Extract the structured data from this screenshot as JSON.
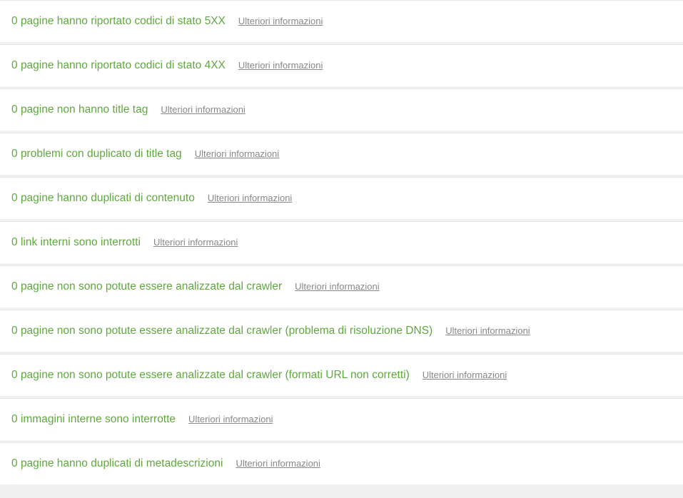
{
  "issues": [
    {
      "count": "0",
      "label": "pagine hanno riportato codici di stato 5XX",
      "more": "Ulteriori informazioni"
    },
    {
      "count": "0",
      "label": "pagine hanno riportato codici di stato 4XX",
      "more": "Ulteriori informazioni"
    },
    {
      "count": "0",
      "label": "pagine non hanno title tag",
      "more": "Ulteriori informazioni"
    },
    {
      "count": "0",
      "label": "problemi con duplicato di title tag",
      "more": "Ulteriori informazioni"
    },
    {
      "count": "0",
      "label": "pagine hanno duplicati di contenuto",
      "more": "Ulteriori informazioni"
    },
    {
      "count": "0",
      "label": "link interni sono interrotti",
      "more": "Ulteriori informazioni"
    },
    {
      "count": "0",
      "label": "pagine non sono potute essere analizzate dal crawler",
      "more": "Ulteriori informazioni"
    },
    {
      "count": "0",
      "label": "pagine non sono potute essere analizzate dal crawler (problema di risoluzione DNS)",
      "more": "Ulteriori informazioni"
    },
    {
      "count": "0",
      "label": "pagine non sono potute essere analizzate dal crawler (formati URL non corretti)",
      "more": "Ulteriori informazioni"
    },
    {
      "count": "0",
      "label": "immagini interne sono interrotte",
      "more": "Ulteriori informazioni"
    },
    {
      "count": "0",
      "label": "pagine hanno duplicati di metadescrizioni",
      "more": "Ulteriori informazioni"
    }
  ]
}
